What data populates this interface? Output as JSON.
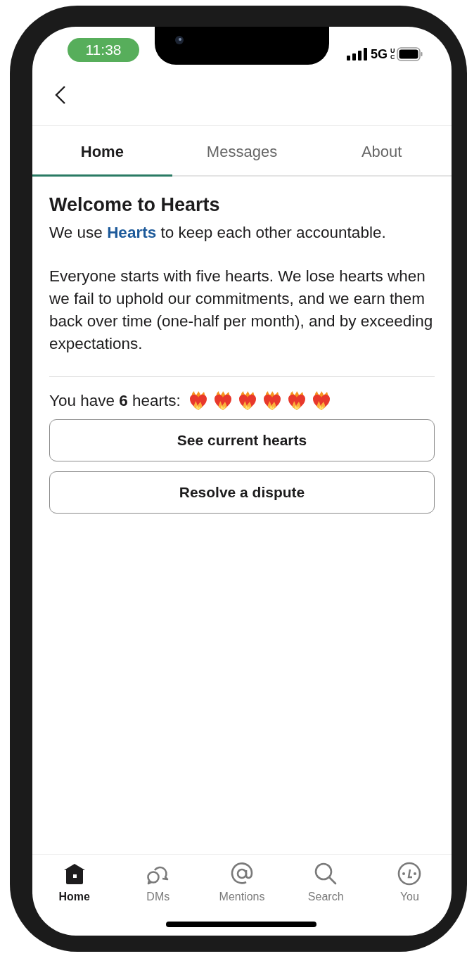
{
  "status_bar": {
    "time": "11:38",
    "network": "5G",
    "network_suffix": "UC"
  },
  "tabs": [
    {
      "label": "Home",
      "selected": true
    },
    {
      "label": "Messages",
      "selected": false
    },
    {
      "label": "About",
      "selected": false
    }
  ],
  "content": {
    "title": "Welcome to Hearts",
    "intro": {
      "before": "We use ",
      "link": "Hearts",
      "after": " to keep each other accountable."
    },
    "description": "Everyone starts with five hearts. We lose hearts when we fail to uphold our commitments, and we earn them back over time (one-half per month), and by exceeding expectations.",
    "hearts_label": "You have **6** hearts:",
    "hearts": {
      "stars": 6
    },
    "buttons": [
      "See current hearts",
      "Resolve a dispute"
    ]
  },
  "bottom_nav": [
    {
      "kind": "home",
      "label": "Home",
      "selected": true
    },
    {
      "kind": "dms",
      "label": "DMs",
      "selected": false
    },
    {
      "kind": "mentions",
      "label": "Mentions",
      "selected": false
    },
    {
      "kind": "search",
      "label": "Search",
      "selected": false
    },
    {
      "kind": "you",
      "label": "You",
      "selected": false
    }
  ]
}
